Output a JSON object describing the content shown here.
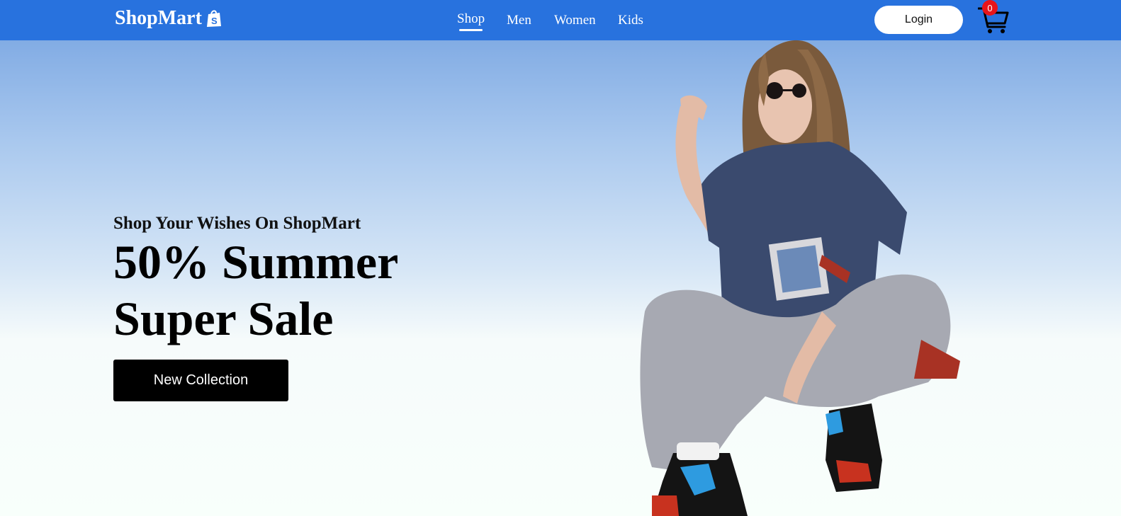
{
  "navbar": {
    "brand": "ShopMart",
    "links": [
      {
        "label": "Shop",
        "active": true
      },
      {
        "label": "Men",
        "active": false
      },
      {
        "label": "Women",
        "active": false
      },
      {
        "label": "Kids",
        "active": false
      }
    ],
    "login_label": "Login",
    "cart_count": "0",
    "brand_icon": "shopify-bag-icon",
    "cart_icon": "shopping-cart-icon"
  },
  "hero": {
    "subtitle": "Shop Your Wishes On ShopMart",
    "title_line1": "50% Summer",
    "title_line2": "Super Sale",
    "cta_label": "New Collection"
  },
  "colors": {
    "nav_bg": "#2872de",
    "badge": "#e8141a",
    "cta_bg": "#000000"
  }
}
